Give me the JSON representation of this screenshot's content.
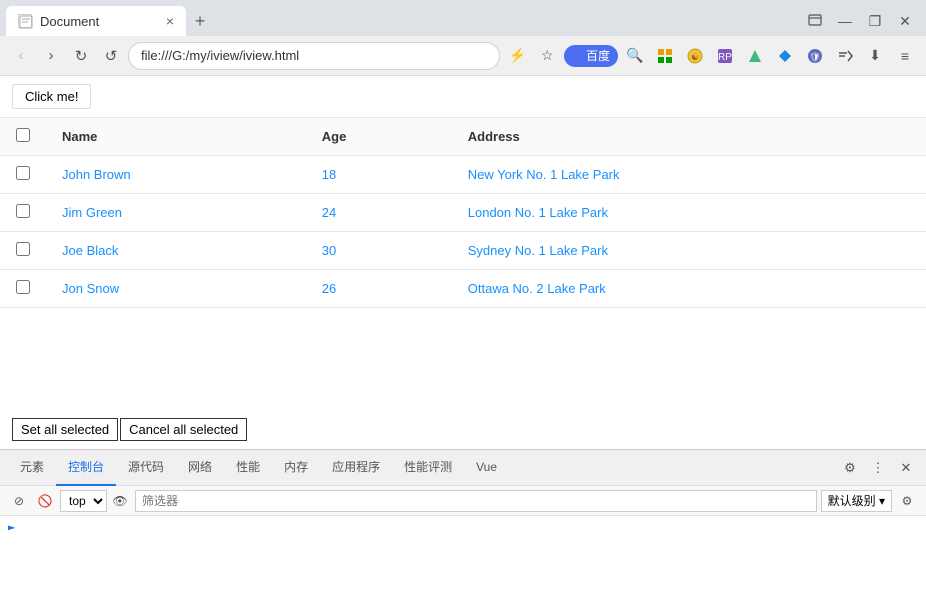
{
  "browser": {
    "tab_title": "Document",
    "tab_close": "×",
    "tab_new": "+",
    "address": "file:///G:/my/iview/iview.html",
    "win_minimize": "—",
    "win_maximize": "❐",
    "win_close": "✕"
  },
  "nav": {
    "back": "‹",
    "forward": "›",
    "reload": "↻",
    "reload_hard": "↺",
    "baidu": "百度",
    "search_icon": "🔍",
    "bolt": "⚡",
    "star": "☆"
  },
  "page": {
    "click_me_label": "Click me!",
    "table": {
      "columns": [
        "",
        "Name",
        "Age",
        "Address"
      ],
      "rows": [
        {
          "name": "John Brown",
          "age": "18",
          "address": "New York No. 1 Lake Park"
        },
        {
          "name": "Jim Green",
          "age": "24",
          "address": "London No. 1 Lake Park"
        },
        {
          "name": "Joe Black",
          "age": "30",
          "address": "Sydney No. 1 Lake Park"
        },
        {
          "name": "Jon Snow",
          "age": "26",
          "address": "Ottawa No. 2 Lake Park"
        }
      ]
    },
    "btn_set_selected": "Set all selected",
    "btn_cancel_selected": "Cancel all selected"
  },
  "devtools": {
    "tabs": [
      "元素",
      "控制台",
      "源代码",
      "网络",
      "性能",
      "内存",
      "应用程序",
      "性能评测",
      "Vue"
    ],
    "active_tab": "控制台",
    "toolbar": {
      "context": "top",
      "filter_placeholder": "筛选器",
      "level": "默认级别"
    }
  }
}
